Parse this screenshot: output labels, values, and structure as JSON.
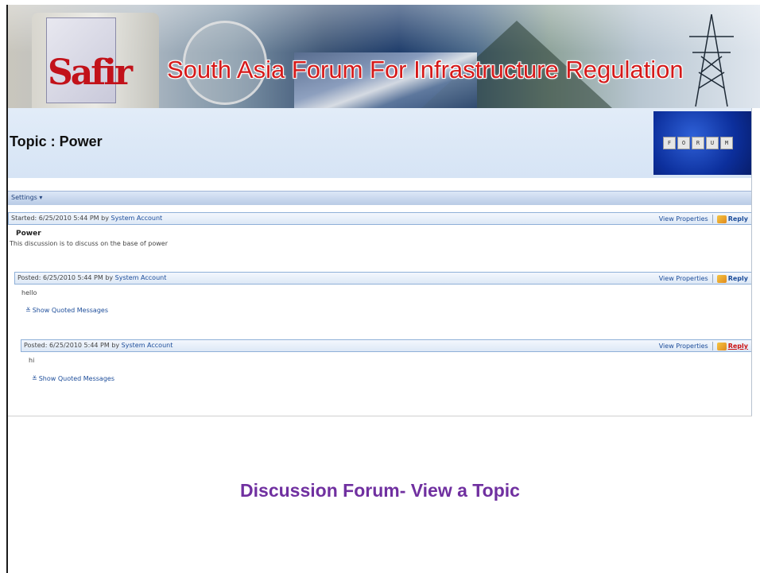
{
  "banner": {
    "logo_text": "Safir",
    "site_title": "South Asia Forum For Infrastructure Regulation"
  },
  "topic": {
    "title": "Topic : Power",
    "forum_image_letters": [
      "F",
      "O",
      "R",
      "U",
      "M"
    ]
  },
  "toolbar": {
    "settings_label": "Settings ▾"
  },
  "posts": [
    {
      "prefix": "Started: 6/25/2010 5:44 PM by ",
      "author": "System Account",
      "view_properties": "View Properties",
      "reply": "Reply",
      "subject": "Power",
      "body": "This discussion is to discuss on the base of power",
      "quoted": ""
    },
    {
      "prefix": "Posted: 6/25/2010 5:44 PM by ",
      "author": "System Account",
      "view_properties": "View Properties",
      "reply": "Reply",
      "subject": "",
      "body": "hello",
      "quoted": "Show Quoted Messages"
    },
    {
      "prefix": "Posted: 6/25/2010 5:44 PM by ",
      "author": "System Account",
      "view_properties": "View Properties",
      "reply": "Reply",
      "subject": "",
      "body": "hi",
      "quoted": "Show Quoted Messages"
    }
  ],
  "caption": "Discussion Forum- View a Topic",
  "colors": {
    "title_red": "#d51a1a",
    "caption_purple": "#7030a0",
    "link_blue": "#1d4d9a",
    "reply_active_red": "#cc1111"
  }
}
